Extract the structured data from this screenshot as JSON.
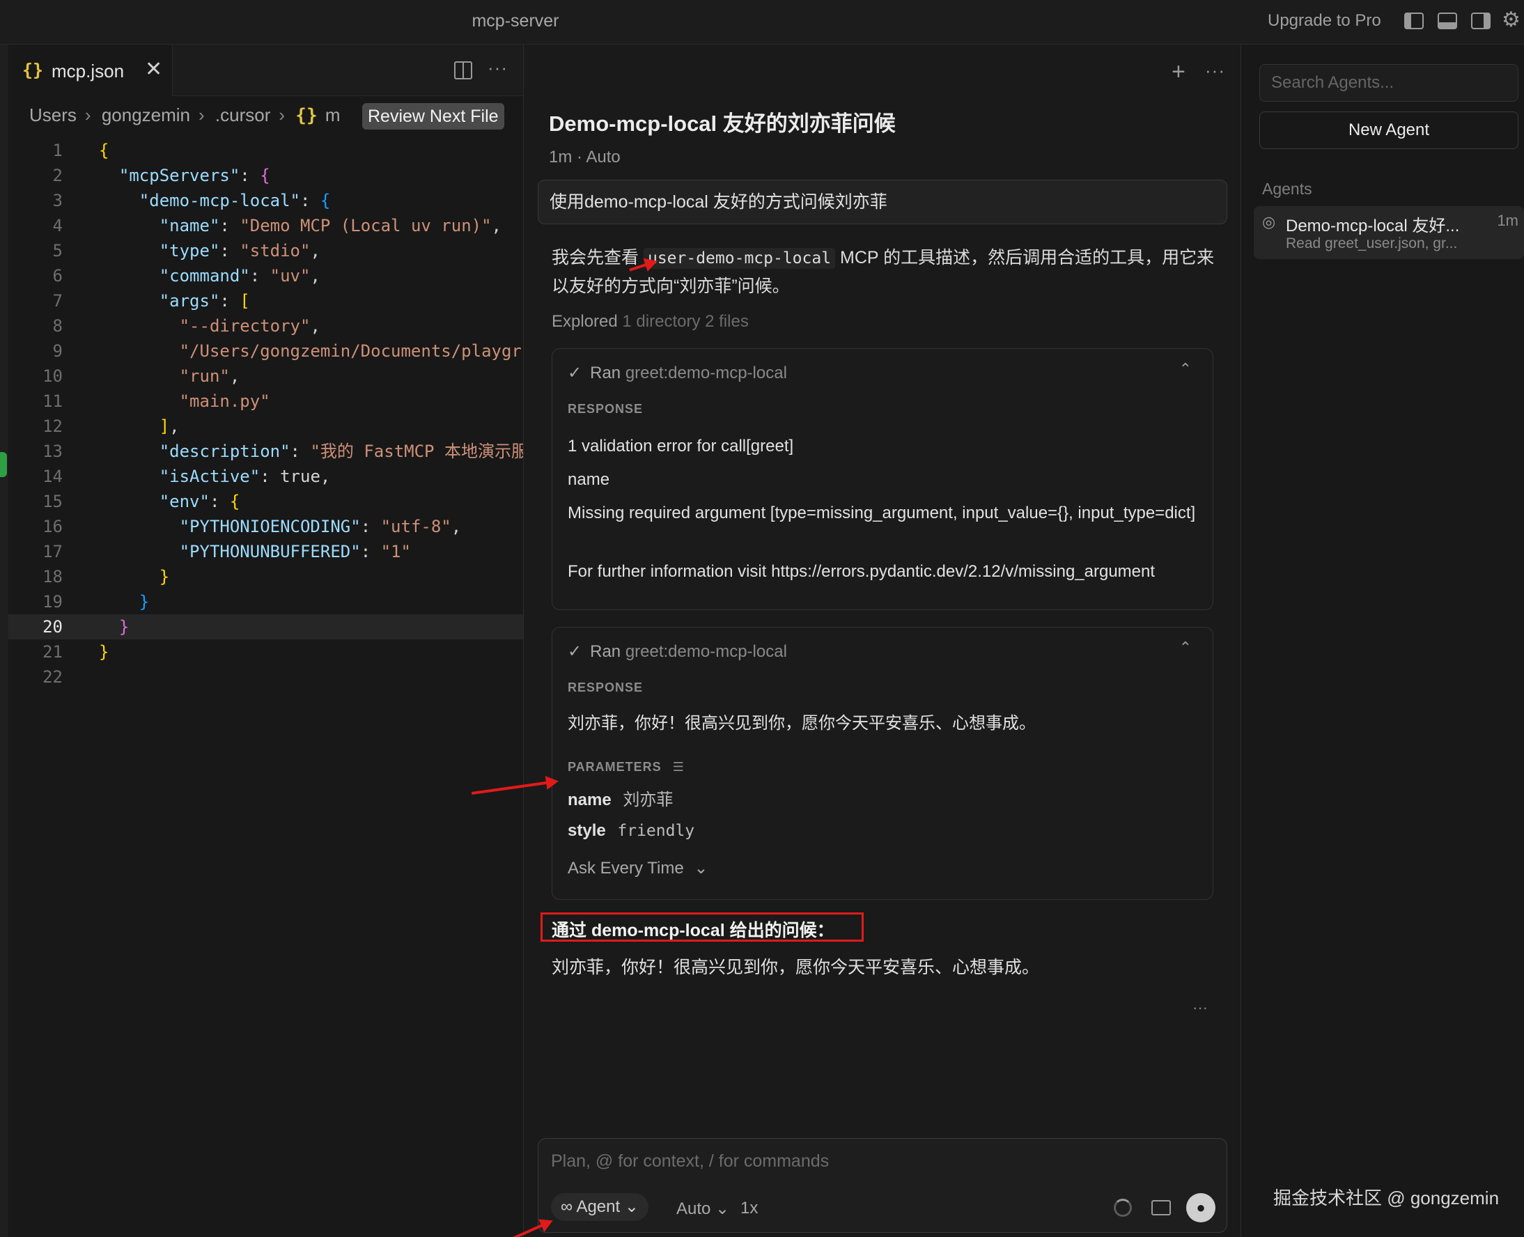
{
  "titlebar": {
    "title": "mcp-server",
    "upgrade": "Upgrade to Pro"
  },
  "editor": {
    "tab": {
      "icon": "{}",
      "name": "mcp.json",
      "close": "✕"
    },
    "breadcrumb": [
      "Users",
      "gongzemin",
      ".cursor",
      "m"
    ],
    "breadcrumb_json_icon": "{}",
    "review_button": "Review Next File",
    "line_numbers": [
      "1",
      "2",
      "3",
      "4",
      "5",
      "6",
      "7",
      "8",
      "9",
      "10",
      "11",
      "12",
      "13",
      "14",
      "15",
      "16",
      "17",
      "18",
      "19",
      "20",
      "21",
      "22"
    ],
    "code": {
      "mcpServers": "\"mcpServers\"",
      "demo": "\"demo-mcp-local\"",
      "name_k": "\"name\"",
      "name_v": "\"Demo MCP (Local uv run)\"",
      "type_k": "\"type\"",
      "type_v": "\"stdio\"",
      "command_k": "\"command\"",
      "command_v": "\"uv\"",
      "args_k": "\"args\"",
      "arg1": "\"--directory\"",
      "arg2": "\"/Users/gongzemin/Documents/playgr",
      "arg3": "\"run\"",
      "arg4": "\"main.py\"",
      "desc_k": "\"description\"",
      "desc_v": "\"我的 FastMCP 本地演示服",
      "active_k": "\"isActive\"",
      "active_v": "true",
      "env_k": "\"env\"",
      "enc_k": "\"PYTHONIOENCODING\"",
      "enc_v": "\"utf-8\"",
      "unbuf_k": "\"PYTHONUNBUFFERED\"",
      "unbuf_v": "\"1\""
    }
  },
  "chat": {
    "title": "Demo-mcp-local 友好的刘亦菲问候",
    "meta": "1m · Auto",
    "user_message": "使用demo-mcp-local 友好的方式问候刘亦菲",
    "assistant_pre": "我会先查看",
    "assistant_code": "user-demo-mcp-local",
    "assistant_post": " MCP 的工具描述，然后调用合适的工具，用它来以友好的方式向“刘亦菲”问候。",
    "explored_label": "Explored",
    "explored_detail": "1 directory 2 files",
    "card1": {
      "ran": "Ran",
      "tool": "greet:demo-mcp-local",
      "response_label": "RESPONSE",
      "lines": [
        "1 validation error for call[greet]",
        "name",
        "Missing required argument [type=missing_argument, input_value={}, input_type=dict]",
        "For further information visit https://errors.pydantic.dev/2.12/v/missing_argument"
      ]
    },
    "card2": {
      "ran": "Ran",
      "tool": "greet:demo-mcp-local",
      "response_label": "RESPONSE",
      "response_text": "刘亦菲，你好！很高兴见到你，愿你今天平安喜乐、心想事成。",
      "parameters_label": "PARAMETERS",
      "params": [
        {
          "name": "name",
          "value": "刘亦菲"
        },
        {
          "name": "style",
          "value": "friendly"
        }
      ],
      "ask": "Ask Every Time"
    },
    "answer_title": "通过 demo-mcp-local 给出的问候：",
    "answer_text": "刘亦菲，你好！很高兴见到你，愿你今天平安喜乐、心想事成。",
    "composer": {
      "placeholder": "Plan, @ for context, / for commands",
      "agent": "Agent",
      "model": "Auto",
      "multiplier": "1x"
    }
  },
  "sidebar": {
    "search_placeholder": "Search Agents...",
    "new_agent": "New Agent",
    "agents_label": "Agents",
    "agents": [
      {
        "title": "Demo-mcp-local 友好...",
        "time": "1m",
        "subtitle": "Read greet_user.json, gr..."
      }
    ]
  },
  "watermark": "掘金技术社区 @ gongzemin",
  "colors": {
    "background": "#191919",
    "highlight_border": "#e11a1a",
    "json_key": "#9cdcfe",
    "json_string": "#ce9178"
  }
}
